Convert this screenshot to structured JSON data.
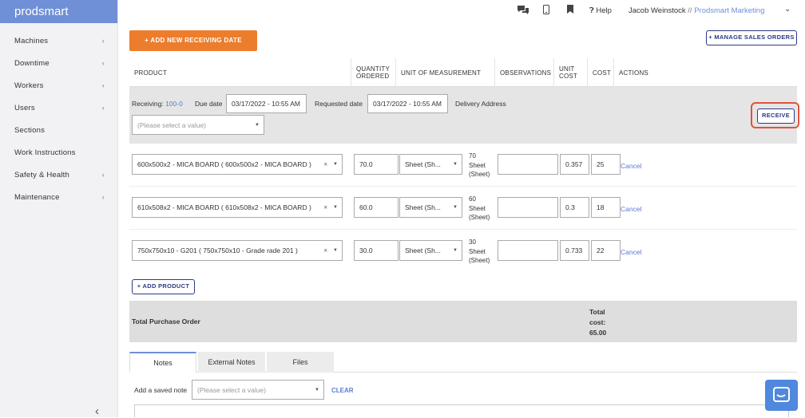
{
  "brand": "prodsmart",
  "sidebar": {
    "items": [
      {
        "label": "Machines",
        "chevron": true
      },
      {
        "label": "Downtime",
        "chevron": true
      },
      {
        "label": "Workers",
        "chevron": true
      },
      {
        "label": "Users",
        "chevron": true
      },
      {
        "label": "Sections",
        "chevron": false
      },
      {
        "label": "Work Instructions",
        "chevron": false
      },
      {
        "label": "Safety & Health",
        "chevron": true
      },
      {
        "label": "Maintenance",
        "chevron": true
      }
    ]
  },
  "topbar": {
    "help": "Help",
    "user_name": "Jacob Weinstock",
    "separator": "//",
    "org": "Prodsmart Marketing"
  },
  "actions": {
    "add_receiving": "+ ADD NEW RECEIVING DATE",
    "manage_sales": "+ MANAGE SALES ORDERS",
    "receive": "RECEIVE",
    "add_product": "+ ADD PRODUCT"
  },
  "table": {
    "headers": {
      "product": "PRODUCT",
      "quantity": "QUANTITY ORDERED",
      "unit": "UNIT OF MEASUREMENT",
      "observations": "OBSERVATIONS",
      "unit_cost": "UNIT COST",
      "cost": "COST",
      "actions": "ACTIONS"
    },
    "rows": [
      {
        "product": "600x500x2 - MICA BOARD ( 600x500x2 - MICA BOARD )",
        "quantity": "70.0",
        "unit": "Sheet (Sh...",
        "measure": [
          "70",
          "Sheet",
          "(Sheet)"
        ],
        "observations": "",
        "unit_cost": "0.357",
        "cost": "25",
        "action": "Cancel"
      },
      {
        "product": "610x508x2 - MICA BOARD ( 610x508x2 - MICA BOARD )",
        "quantity": "60.0",
        "unit": "Sheet (Sh...",
        "measure": [
          "60",
          "Sheet",
          "(Sheet)"
        ],
        "observations": "",
        "unit_cost": "0.3",
        "cost": "18",
        "action": "Cancel"
      },
      {
        "product": "750x750x10 - G201 ( 750x750x10 - Grade rade 201 )",
        "quantity": "30.0",
        "unit": "Sheet (Sh...",
        "measure": [
          "30",
          "Sheet",
          "(Sheet)"
        ],
        "observations": "",
        "unit_cost": "0.733",
        "cost": "22",
        "action": "Cancel"
      }
    ]
  },
  "receiving": {
    "label": "Receiving:",
    "id": "100-0",
    "due_label": "Due date",
    "due_value": "03/17/2022 - 10:55 AM",
    "requested_label": "Requested date",
    "requested_value": "03/17/2022 - 10:55 AM",
    "delivery_label": "Delivery Address",
    "delivery_placeholder": "(Please select a value)"
  },
  "totals": {
    "label": "Total Purchase Order",
    "cost_label": [
      "Total",
      "cost:"
    ],
    "cost_value": "65.00"
  },
  "tabs": [
    "Notes",
    "External Notes",
    "Files"
  ],
  "notes": {
    "saved_label": "Add a saved note",
    "saved_placeholder": "(Please select a value)",
    "clear": "CLEAR"
  }
}
